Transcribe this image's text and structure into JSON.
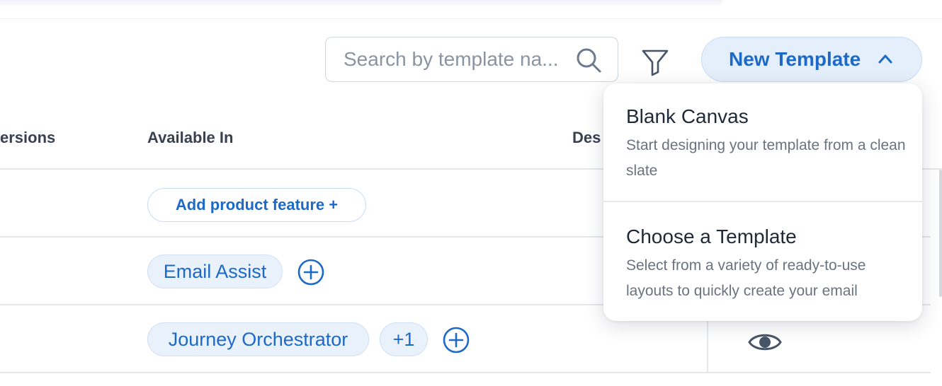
{
  "search": {
    "placeholder": "Search by template na...",
    "value": ""
  },
  "toolbar": {
    "new_template_label": "New Template"
  },
  "table": {
    "headers": {
      "versions": "ersions",
      "available_in": "Available In",
      "description": "Des"
    },
    "rows": [
      {
        "available_in": {
          "add_label": "Add product feature +"
        }
      },
      {
        "available_in": {
          "chips": [
            "Email Assist"
          ]
        }
      },
      {
        "available_in": {
          "chips": [
            "Journey Orchestrator",
            "+1"
          ]
        }
      }
    ]
  },
  "dropdown": {
    "items": [
      {
        "title": "Blank Canvas",
        "description": "Start designing your template from a clean slate"
      },
      {
        "title": "Choose a Template",
        "description": "Select from a variety of ready-to-use layouts to quickly create your email"
      }
    ]
  },
  "colors": {
    "accent": "#1c69c7",
    "chip_bg": "#e9f1fb",
    "border": "#e5e7eb"
  },
  "icons": [
    "search-icon",
    "filter-icon",
    "chevron-up-icon",
    "plus-circle-icon",
    "eye-icon"
  ]
}
